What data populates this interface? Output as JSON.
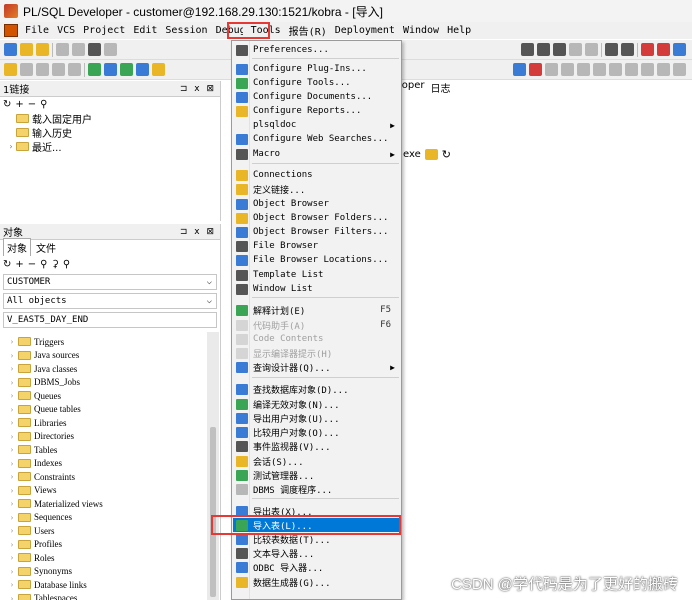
{
  "window": {
    "title": "PL/SQL Developer - customer@192.168.29.130:1521/kobra - [导入]"
  },
  "menubar": {
    "items": [
      "File",
      "VCS",
      "Project",
      "Edit",
      "Session",
      "Debug",
      "Tools",
      "报告(R)",
      "Deployment",
      "Window",
      "Help"
    ]
  },
  "connections_panel": {
    "title": "1链接",
    "pin": "⊐ x ⊠",
    "items": [
      "载入固定用户",
      "输入历史",
      "最近..."
    ]
  },
  "objects_panel": {
    "title": "对象",
    "pin": "⊐ x ⊠",
    "tabs": [
      "对象",
      "文件"
    ],
    "user_select": "CUSTOMER",
    "filter_select": "All objects",
    "search_value": "V_EAST5_DAY_END",
    "tree_items": [
      "Triggers",
      "Java sources",
      "Java classes",
      "DBMS_Jobs",
      "Queues",
      "Queue tables",
      "Libraries",
      "Directories",
      "Tables",
      "Indexes",
      "Constraints",
      "Views",
      "Materialized views",
      "Sequences",
      "Users",
      "Profiles",
      "Roles",
      "Synonyms",
      "Database links",
      "Tablespaces"
    ]
  },
  "right_pane": {
    "tab_labels": [
      "loper",
      "日志"
    ],
    "exe_text": "exe"
  },
  "tools_menu": {
    "items": [
      {
        "label": "Preferences...",
        "icon": "wrench-icon"
      },
      {
        "label": "Configure Plug-Ins...",
        "icon": "plugin-icon"
      },
      {
        "label": "Configure Tools...",
        "icon": "tools-icon"
      },
      {
        "label": "Configure Documents...",
        "icon": "documents-icon"
      },
      {
        "label": "Configure Reports...",
        "icon": "reports-icon"
      },
      {
        "label": "plsqldoc",
        "icon": "",
        "submenu": true
      },
      {
        "label": "Configure Web Searches...",
        "icon": "web-search-icon"
      },
      {
        "label": "Macro",
        "icon": "macro-icon",
        "submenu": true
      },
      {
        "label": "Connections",
        "icon": "connections-icon"
      },
      {
        "label": "定义链接...",
        "icon": "define-link-icon"
      },
      {
        "label": "Object Browser",
        "icon": "object-browser-icon"
      },
      {
        "label": "Object Browser Folders...",
        "icon": "folders-icon"
      },
      {
        "label": "Object Browser Filters...",
        "icon": "filters-icon"
      },
      {
        "label": "File Browser",
        "icon": "file-browser-icon"
      },
      {
        "label": "File Browser Locations...",
        "icon": "locations-icon"
      },
      {
        "label": "Template List",
        "icon": "template-icon"
      },
      {
        "label": "Window List",
        "icon": "window-list-icon"
      },
      {
        "label": "解释计划(E)",
        "shortcut": "F5",
        "icon": "explain-plan-icon"
      },
      {
        "label": "代码助手(A)",
        "shortcut": "F6",
        "icon": "code-assistant-icon",
        "disabled": true
      },
      {
        "label": "Code Contents",
        "icon": "code-contents-icon",
        "disabled": true
      },
      {
        "label": "显示编译器提示(H)",
        "icon": "compiler-hints-icon",
        "disabled": true
      },
      {
        "label": "查询设计器(Q)...",
        "icon": "query-designer-icon",
        "submenu": true
      },
      {
        "label": "查找数据库对象(D)...",
        "icon": "find-objects-icon"
      },
      {
        "label": "编译无效对象(N)...",
        "icon": "compile-icon"
      },
      {
        "label": "导出用户对象(U)...",
        "icon": "export-user-icon"
      },
      {
        "label": "比较用户对象(O)...",
        "icon": "compare-user-icon"
      },
      {
        "label": "事件监视器(V)...",
        "icon": "event-monitor-icon"
      },
      {
        "label": "会话(S)...",
        "icon": "sessions-icon"
      },
      {
        "label": "测试管理器...",
        "icon": "test-manager-icon"
      },
      {
        "label": "DBMS 调度程序...",
        "icon": "dbms-scheduler-icon"
      },
      {
        "label": "导出表(X)...",
        "icon": "export-tables-icon"
      },
      {
        "label": "导入表(L)...",
        "icon": "import-tables-icon",
        "highlighted": true
      },
      {
        "label": "比较表数据(T)...",
        "icon": "compare-table-icon"
      },
      {
        "label": "文本导入器...",
        "icon": "text-importer-icon"
      },
      {
        "label": "ODBC 导入器...",
        "icon": "odbc-importer-icon"
      },
      {
        "label": "数据生成器(G)...",
        "icon": "data-generator-icon"
      }
    ]
  },
  "watermark": "CSDN @学代码是为了更好的搬砖",
  "colors": {
    "highlight": "#0078d7",
    "annotation_box": "#e53935"
  }
}
